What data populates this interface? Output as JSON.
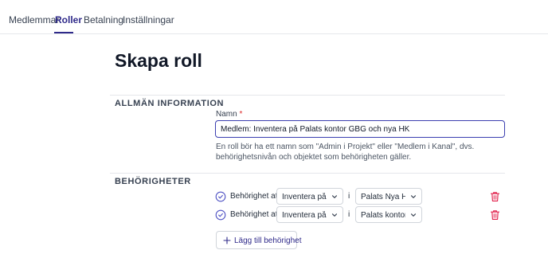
{
  "tabs": [
    {
      "label": "Medlemmar",
      "active": false
    },
    {
      "label": "Roller",
      "active": true
    },
    {
      "label": "Betalning",
      "active": false
    },
    {
      "label": "Inställningar",
      "active": false
    }
  ],
  "page": {
    "title": "Skapa roll"
  },
  "general": {
    "heading": "ALLMÄN INFORMATION",
    "name_label": "Namn",
    "required_mark": "*",
    "name_value": "Medlem: Inventera på Palats kontor GBG och nya HK",
    "help_text": "En roll bör ha ett namn som \"Admin i Projekt\" eller \"Medlem i Kanal\", dvs. behörighetsnivån och objektet som behörigheten gäller."
  },
  "permissions": {
    "heading": "BEHÖRIGHETER",
    "rows": [
      {
        "prefix": "Behörighet att",
        "action": "Inventera på pl",
        "connector": "i",
        "target": "Palats Nya HK"
      },
      {
        "prefix": "Behörighet att",
        "action": "Inventera på pl",
        "connector": "i",
        "target": "Palats kontor G"
      }
    ],
    "add_label": "Lägg till behörighet"
  },
  "colors": {
    "accent": "#2f2a8a",
    "focus_border": "#3b3fb0",
    "required": "#dc2626",
    "delete": "#e11d48"
  },
  "icons": {
    "row_status": "check-circle-icon",
    "dropdown": "chevron-down-icon",
    "delete": "trash-icon",
    "add": "plus-icon"
  }
}
